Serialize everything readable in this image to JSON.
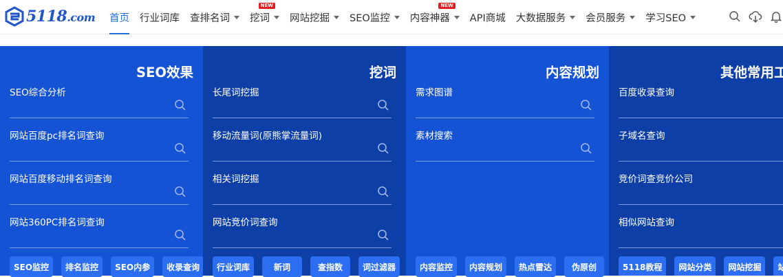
{
  "header": {
    "logo_text": "5118",
    "logo_suffix": ".com",
    "nav": [
      {
        "label": "首页",
        "active": true,
        "dropdown": false,
        "badge": ""
      },
      {
        "label": "行业词库",
        "active": false,
        "dropdown": false,
        "badge": ""
      },
      {
        "label": "查排名词",
        "active": false,
        "dropdown": true,
        "badge": ""
      },
      {
        "label": "挖词",
        "active": false,
        "dropdown": true,
        "badge": "NEW"
      },
      {
        "label": "网站挖掘",
        "active": false,
        "dropdown": true,
        "badge": ""
      },
      {
        "label": "SEO监控",
        "active": false,
        "dropdown": true,
        "badge": ""
      },
      {
        "label": "内容神器",
        "active": false,
        "dropdown": true,
        "badge": "NEW"
      },
      {
        "label": "API商城",
        "active": false,
        "dropdown": false,
        "badge": ""
      },
      {
        "label": "大数据服务",
        "active": false,
        "dropdown": true,
        "badge": ""
      },
      {
        "label": "会员服务",
        "active": false,
        "dropdown": true,
        "badge": ""
      },
      {
        "label": "学习SEO",
        "active": false,
        "dropdown": true,
        "badge": ""
      }
    ],
    "tools": [
      "search-icon",
      "cloud-download-icon",
      "bell-icon"
    ]
  },
  "colors": {
    "accent": "#1f6fe0",
    "panel_light": "#1553d5",
    "panel_dark": "#0d3fa7",
    "tag_bg": "#2b6ef2",
    "badge": "#e02020"
  },
  "panels": [
    {
      "title": "SEO效果",
      "fields": [
        "SEO综合分析",
        "网站百度pc排名词查询",
        "网站百度移动排名词查询",
        "网站360PC排名词查询"
      ],
      "tags": [
        "SEO监控",
        "排名监控",
        "SEO内参",
        "收录查询"
      ]
    },
    {
      "title": "挖词",
      "fields": [
        "长尾词挖掘",
        "移动流量词(原熊掌流量词)",
        "相关词挖掘",
        "网站竞价词查询"
      ],
      "tags": [
        "行业词库",
        "新词",
        "查指数",
        "词过滤器"
      ]
    },
    {
      "title": "内容规划",
      "fields": [
        "需求图谱",
        "素材搜索"
      ],
      "tags": [
        "内容监控",
        "内容规划",
        "热点雷达",
        "伪原创"
      ]
    },
    {
      "title": "其他常用工具",
      "fields": [
        "百度收录查询",
        "子域名查询",
        "竞价词查竞价公司",
        "相似网站查询"
      ],
      "tags": [
        "5118教程",
        "网站分类",
        "网站挖掘",
        "站长帮手"
      ]
    }
  ]
}
